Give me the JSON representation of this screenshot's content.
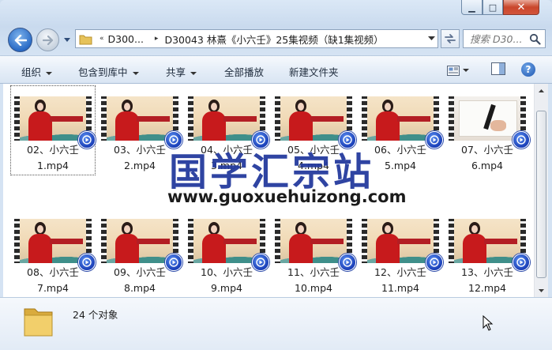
{
  "window": {
    "minimize_glyph": "▁",
    "maximize_glyph": "□",
    "close_glyph": "✕"
  },
  "address": {
    "overflow": "«",
    "segments": [
      "D300...",
      "D30043 林熹《小六壬》25集视频（缺1集视频）"
    ],
    "separator": "▸"
  },
  "search": {
    "placeholder": "搜索 D30..."
  },
  "toolbar": {
    "organize": "组织",
    "include_in_library": "包含到库中",
    "share": "共享",
    "play_all": "全部播放",
    "new_folder": "新建文件夹",
    "help": "?"
  },
  "files": [
    {
      "line1": "02、小六壬",
      "line2": "1.mp4",
      "thumb": "teacher"
    },
    {
      "line1": "03、小六壬",
      "line2": "2.mp4",
      "thumb": "teacher"
    },
    {
      "line1": "04、小六壬",
      "line2": "3.mp4",
      "thumb": "teacher"
    },
    {
      "line1": "05、小六壬",
      "line2": "4.mp4",
      "thumb": "teacher"
    },
    {
      "line1": "06、小六壬",
      "line2": "5.mp4",
      "thumb": "teacher"
    },
    {
      "line1": "07、小六壬",
      "line2": "6.mp4",
      "thumb": "writing"
    },
    {
      "line1": "08、小六壬",
      "line2": "7.mp4",
      "thumb": "teacher"
    },
    {
      "line1": "09、小六壬",
      "line2": "8.mp4",
      "thumb": "teacher"
    },
    {
      "line1": "10、小六壬",
      "line2": "9.mp4",
      "thumb": "teacher"
    },
    {
      "line1": "11、小六壬",
      "line2": "10.mp4",
      "thumb": "teacher"
    },
    {
      "line1": "12、小六壬",
      "line2": "11.mp4",
      "thumb": "teacher"
    },
    {
      "line1": "13、小六壬",
      "line2": "12.mp4",
      "thumb": "teacher"
    }
  ],
  "watermark": {
    "title": "国学汇宗站",
    "url": "www.guoxuehuizong.com"
  },
  "details": {
    "count": "24 个对象"
  },
  "colors": {
    "watermark_title": "#243a9e",
    "accent": "#2a6bc6"
  }
}
